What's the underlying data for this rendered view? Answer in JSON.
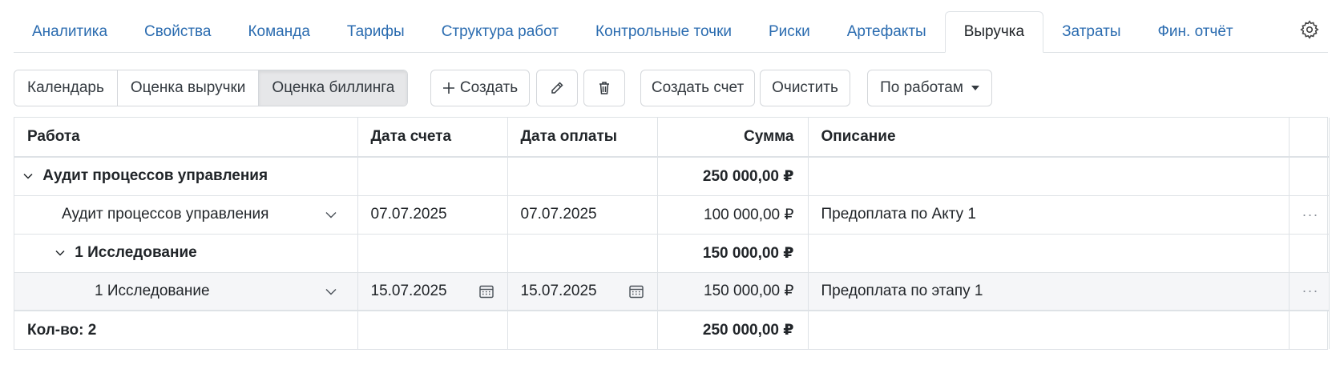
{
  "tabs": [
    {
      "label": "Аналитика"
    },
    {
      "label": "Свойства"
    },
    {
      "label": "Команда"
    },
    {
      "label": "Тарифы"
    },
    {
      "label": "Структура работ"
    },
    {
      "label": "Контрольные точки"
    },
    {
      "label": "Риски"
    },
    {
      "label": "Артефакты"
    },
    {
      "label": "Выручка",
      "active": true
    },
    {
      "label": "Затраты"
    },
    {
      "label": "Фин. отчёт"
    }
  ],
  "toolbar": {
    "view_calendar": "Календарь",
    "view_revenue_estimate": "Оценка выручки",
    "view_billing_estimate": "Оценка биллинга",
    "create_label": "Создать",
    "create_invoice_label": "Создать счет",
    "clear_label": "Очистить",
    "group_by_label": "По работам"
  },
  "table": {
    "columns": {
      "work": "Работа",
      "invoice_date": "Дата счета",
      "payment_date": "Дата оплаты",
      "amount": "Сумма",
      "description": "Описание"
    },
    "rows": [
      {
        "type": "group",
        "work": "Аудит процессов управления",
        "amount": "250 000,00 ₽"
      },
      {
        "type": "item",
        "work": "Аудит процессов управления",
        "invoice_date": "07.07.2025",
        "payment_date": "07.07.2025",
        "amount": "100 000,00 ₽",
        "description": "Предоплата по Акту 1"
      },
      {
        "type": "group",
        "work": "1 Исследование",
        "amount": "150 000,00 ₽"
      },
      {
        "type": "item",
        "work": "1 Исследование",
        "invoice_date": "15.07.2025",
        "payment_date": "15.07.2025",
        "amount": "150 000,00 ₽",
        "description": "Предоплата по этапу 1"
      }
    ],
    "footer": {
      "count_label": "Кол-во: 2",
      "total": "250 000,00 ₽"
    }
  },
  "colors": {
    "tab_link": "#2b6cb0",
    "border": "#dee2e6",
    "active_segment": "#e6e7e9",
    "selected_row": "#f5f6f8"
  }
}
